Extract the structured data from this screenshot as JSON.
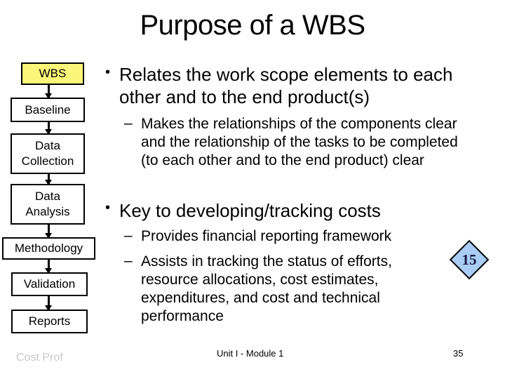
{
  "slide": {
    "title": "Purpose of a WBS",
    "flowchart": {
      "steps": [
        {
          "label": "WBS",
          "highlight": true
        },
        {
          "label": "Baseline"
        },
        {
          "label": "Data\nCollection"
        },
        {
          "label": "Data\nAnalysis"
        },
        {
          "label": "Methodology"
        },
        {
          "label": "Validation"
        },
        {
          "label": "Reports"
        }
      ],
      "highlight_color": "#fbf57a"
    },
    "bullets": [
      {
        "text": "Relates the work scope elements to each other and to the end product(s)",
        "subitems": [
          "Makes the relationships of the components clear and the relationship of the tasks to be completed (to each other and to the end product) clear"
        ]
      },
      {
        "text": "Key to developing/tracking costs",
        "subitems": [
          "Provides financial reporting framework",
          "Assists in tracking the status of efforts, resource allocations, cost estimates, expenditures, and cost and technical performance"
        ]
      }
    ],
    "badge": {
      "number": "15",
      "color": "#a9cdf5"
    },
    "footer": {
      "left": "Cost Prof",
      "center": "Unit I - Module 1",
      "page_number": "35"
    }
  }
}
